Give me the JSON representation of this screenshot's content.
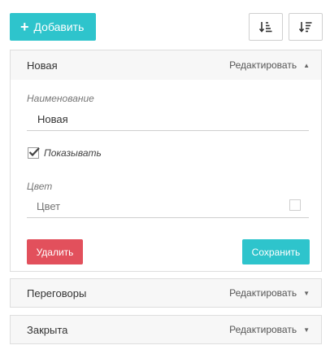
{
  "toolbar": {
    "add_label": "Добавить",
    "sort_asc_icon": "sort-ascending-icon",
    "sort_desc_icon": "sort-descending-icon"
  },
  "statuses": [
    {
      "title": "Новая",
      "edit_label": "Редактировать",
      "expanded": true,
      "form": {
        "name_label": "Наименование",
        "name_value": "Новая",
        "show_label": "Показывать",
        "show_checked": true,
        "color_label": "Цвет",
        "color_placeholder": "Цвет",
        "delete_label": "Удалить",
        "save_label": "Сохранить"
      }
    },
    {
      "title": "Переговоры",
      "edit_label": "Редактировать",
      "expanded": false
    },
    {
      "title": "Закрыта",
      "edit_label": "Редактировать",
      "expanded": false
    }
  ],
  "colors": {
    "accent": "#2ec4cc",
    "danger": "#e2505c",
    "header_bg": "#f7f7f7"
  }
}
